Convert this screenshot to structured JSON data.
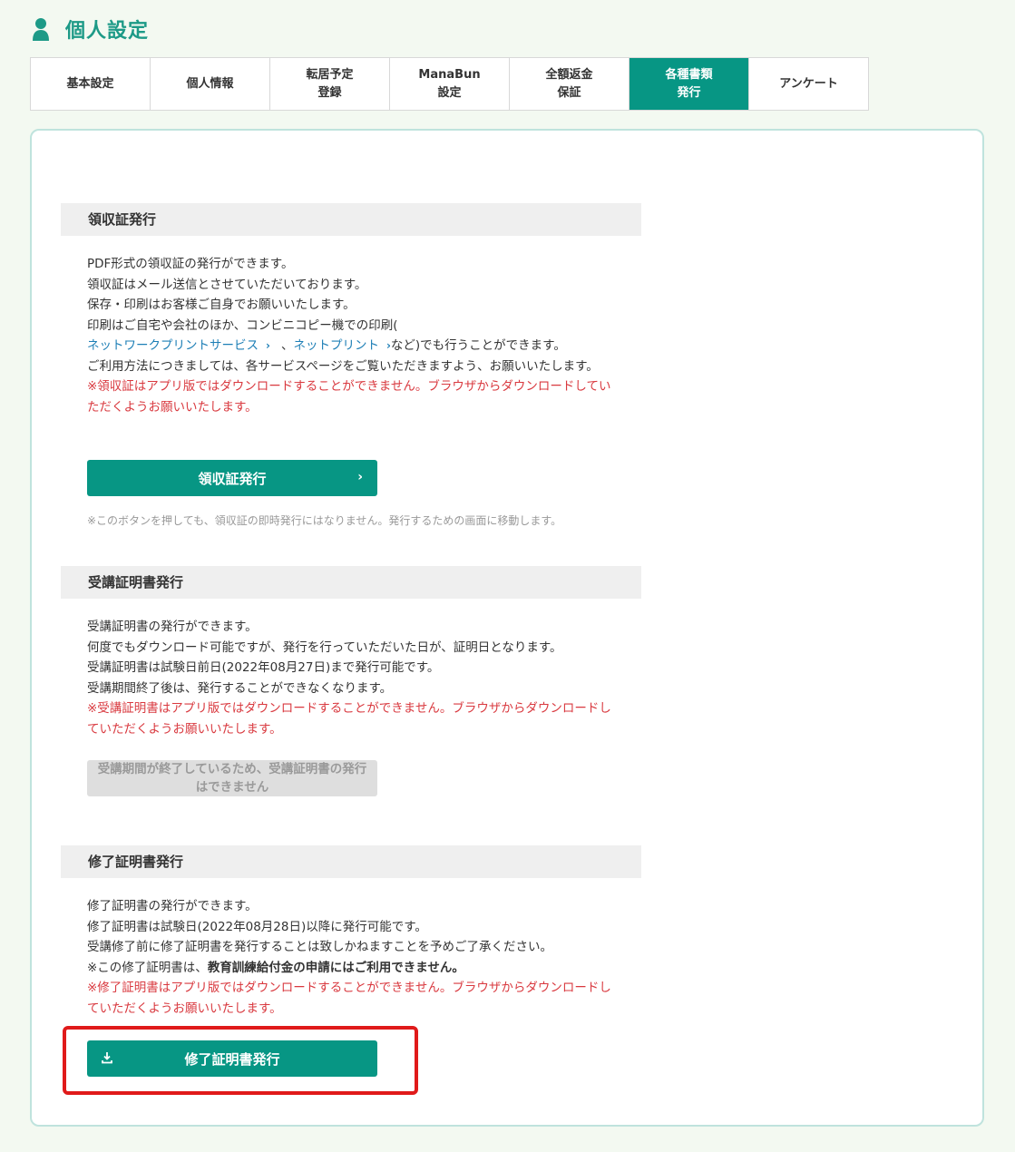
{
  "header": {
    "title": "個人設定",
    "icon": "user-icon"
  },
  "tabs": [
    {
      "label": "基本設定",
      "active": false
    },
    {
      "label": "個人情報",
      "active": false
    },
    {
      "label": "転居予定\n登録",
      "active": false
    },
    {
      "label": "ManaBun\n設定",
      "active": false
    },
    {
      "label": "全額返金\n保証",
      "active": false
    },
    {
      "label": "各種書類\n発行",
      "active": true
    },
    {
      "label": "アンケート",
      "active": false
    }
  ],
  "receipt": {
    "heading": "領収証発行",
    "lines": [
      "PDF形式の領収証の発行ができます。",
      "領収証はメール送信とさせていただいております。",
      "保存・印刷はお客様ご自身でお願いいたします。",
      "印刷はご自宅や会社のほか、コンビニコピー機での印刷("
    ],
    "link1": "ネットワークプリントサービス",
    "sep": "、",
    "link2": "ネットプリント",
    "link_tail": "など)でも行うことができます。",
    "line_after": "ご利用方法につきましては、各サービスページをご覧いただきますよう、お願いいたします。",
    "warning": "※領収証はアプリ版ではダウンロードすることができません。ブラウザからダウンロードしていただくようお願いいたします。",
    "button": "領収証発行",
    "note": "※このボタンを押しても、領収証の即時発行にはなりません。発行するための画面に移動します。"
  },
  "attendance": {
    "heading": "受講証明書発行",
    "lines": [
      "受講証明書の発行ができます。",
      "何度でもダウンロード可能ですが、発行を行っていただいた日が、証明日となります。",
      "受講証明書は試験日前日(2022年08月27日)まで発行可能です。",
      "受講期間終了後は、発行することができなくなります。"
    ],
    "warning": "※受講証明書はアプリ版ではダウンロードすることができません。ブラウザからダウンロードしていただくようお願いいたします。",
    "button_disabled": "受講期間が終了しているため、受講証明書の発行はできません"
  },
  "completion": {
    "heading": "修了証明書発行",
    "lines": [
      "修了証明書の発行ができます。",
      "修了証明書は試験日(2022年08月28日)以降に発行可能です。",
      "受講修了前に修了証明書を発行することは致しかねますことを予めご了承ください。"
    ],
    "note_prefix": "※この修了証明書は、",
    "note_bold": "教育訓練給付金の申請にはご利用できません。",
    "warning": "※修了証明書はアプリ版ではダウンロードすることができません。ブラウザからダウンロードしていただくようお願いいたします。",
    "button": "修了証明書発行"
  },
  "colors": {
    "accent": "#079684",
    "warning": "#d9393f",
    "link": "#1e7fb6",
    "highlight": "#e01a1a"
  }
}
